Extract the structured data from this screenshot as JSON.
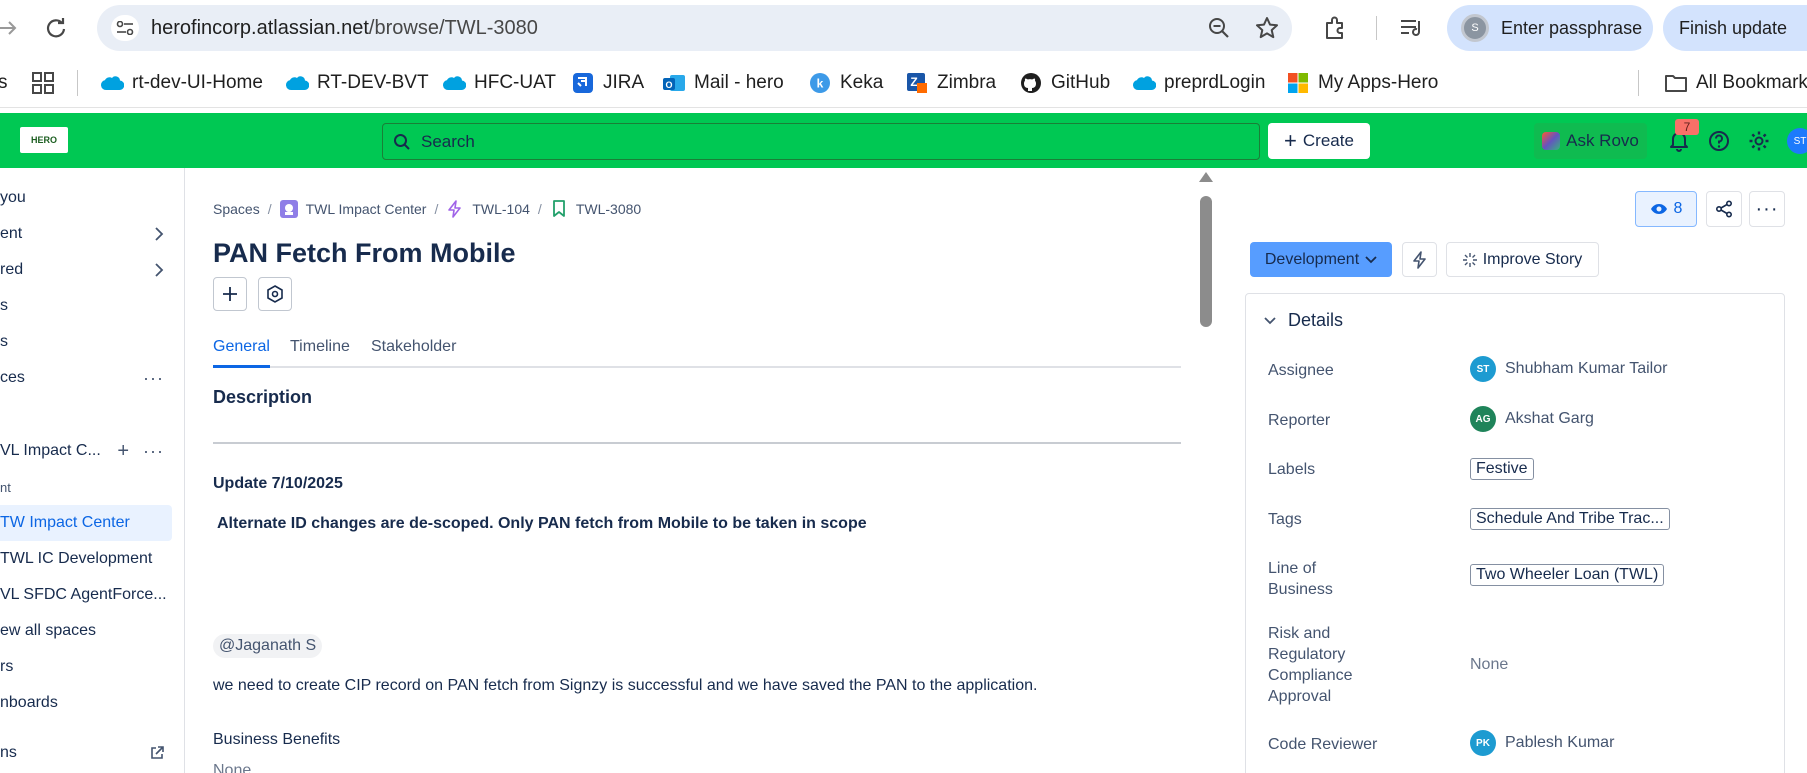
{
  "browser": {
    "url_host": "herofincorp.atlassian.net",
    "url_path": "/browse/TWL-3080",
    "passphrase_label": "Enter passphrase",
    "passphrase_avatar": "S",
    "finish_update_label": "Finish update",
    "bookmarks": [
      {
        "label": "rt-dev-UI-Home",
        "icon": "salesforce-cloud-icon"
      },
      {
        "label": "RT-DEV-BVT",
        "icon": "salesforce-cloud-icon"
      },
      {
        "label": "HFC-UAT",
        "icon": "salesforce-cloud-icon"
      },
      {
        "label": "JIRA",
        "icon": "jira-icon"
      },
      {
        "label": "Mail - hero",
        "icon": "outlook-icon"
      },
      {
        "label": "Keka",
        "icon": "keka-icon"
      },
      {
        "label": "Zimbra",
        "icon": "zimbra-icon"
      },
      {
        "label": "GitHub",
        "icon": "github-icon"
      },
      {
        "label": "preprdLogin",
        "icon": "salesforce-cloud-icon"
      },
      {
        "label": "My Apps-Hero",
        "icon": "microsoft-icon"
      }
    ],
    "bookmarks_left_fragment": "s",
    "all_bookmarks_label": "All Bookmarks"
  },
  "topnav": {
    "logo_text": "HERO",
    "search_placeholder": "Search",
    "create_label": "Create",
    "ask_rovo_label": "Ask Rovo",
    "notification_count": "7",
    "user_initials": "ST",
    "colors": {
      "bar": "#00c853"
    }
  },
  "sidebar": {
    "items": [
      {
        "label": "you",
        "right": ""
      },
      {
        "label": "ent",
        "right": "chevron"
      },
      {
        "label": "red",
        "right": "chevron"
      },
      {
        "label": "s",
        "right": ""
      },
      {
        "label": "s",
        "right": ""
      },
      {
        "label": "ces",
        "right": "more"
      },
      {
        "label": "VL Impact C...",
        "right": "plus-more"
      },
      {
        "label": "nt",
        "right": ""
      },
      {
        "label": "TW Impact Center",
        "right": ""
      },
      {
        "label": "TWL IC Development",
        "right": ""
      },
      {
        "label": "VL SFDC AgentForce...",
        "right": ""
      },
      {
        "label": "ew all spaces",
        "right": ""
      },
      {
        "label": "rs",
        "right": ""
      },
      {
        "label": "nboards",
        "right": ""
      },
      {
        "label": "ns",
        "right": "external"
      }
    ]
  },
  "breadcrumb": {
    "spaces": "Spaces",
    "project": "TWL Impact Center",
    "epic": "TWL-104",
    "issue": "TWL-3080"
  },
  "issue": {
    "title": "PAN Fetch From Mobile",
    "tabs": [
      "General",
      "Timeline",
      "Stakeholder"
    ],
    "active_tab": "General",
    "description_heading": "Description",
    "update_line": "Update 7/10/2025",
    "alt_id_line": "Alternate ID changes are de-scoped.  Only PAN fetch from Mobile to be taken in scope",
    "mention": "@Jaganath S",
    "cip_line": "we need to create CIP record on PAN fetch from Signzy is successful and we have saved the PAN to the application.",
    "business_benefits_label": "Business Benefits",
    "business_benefits_value": "None"
  },
  "right_panel": {
    "watchers_count": "8",
    "status_label": "Development",
    "improve_story_label": "Improve Story",
    "details_heading": "Details",
    "fields": {
      "assignee": {
        "label": "Assignee",
        "value": "Shubham Kumar Tailor",
        "initials": "ST",
        "color": "#1d9bd1"
      },
      "reporter": {
        "label": "Reporter",
        "value": "Akshat Garg",
        "initials": "AG",
        "color": "#1f845a"
      },
      "labels": {
        "label": "Labels",
        "value": "Festive"
      },
      "tags": {
        "label": "Tags",
        "value": "Schedule And Tribe Trac..."
      },
      "line_of_business": {
        "label": "Line of Business",
        "value": "Two Wheeler Loan (TWL)"
      },
      "risk": {
        "label": "Risk and Regulatory Compliance Approval",
        "value": "None"
      },
      "code_reviewer": {
        "label": "Code Reviewer",
        "value": "Pablesh Kumar",
        "initials": "PK",
        "color": "#1d9bd1"
      }
    }
  }
}
